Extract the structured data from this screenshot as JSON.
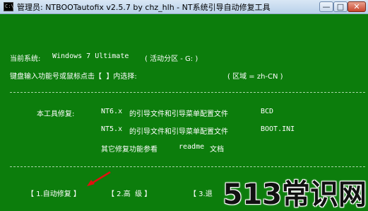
{
  "window": {
    "title": "管理员:  NTBOOTautofix v2.5.7 by chz_hlh - NT系统引导自动修复工具",
    "icon_label": "C:\\",
    "controls": {
      "minimize": "—",
      "maximize": "□",
      "close": "✕"
    },
    "background_color": "#0c7d0c",
    "text_color": "#ffffff"
  },
  "status": {
    "current_system_label": "当前系统:",
    "current_system_value": "Windows 7 Ultimate",
    "active_partition": "( 活动分区 - G: )"
  },
  "prompt": {
    "instruction": "键盘输入功能号或鼠标点击【  】内选择:",
    "locale": "( 区域 = zh-CN )"
  },
  "divider_text": "",
  "repair_info": {
    "heading": "本工具修复:",
    "line1_prefix": "NT6.x",
    "line1_text": "的引导文件和引导菜单配置文件",
    "line1_file": "BCD",
    "line2_prefix": "NT5.x",
    "line2_text": "的引导文件和引导菜单配置文件",
    "line2_file": "BOOT.INI",
    "line3_text": "其它修复功能参看",
    "line3_doc": "readme",
    "line3_suffix": "文档"
  },
  "menu": {
    "item1": "【 1.自动修复 】",
    "item2": "【 2.高  级 】",
    "item3": "【 3.退"
  },
  "watermark": "513常识网"
}
